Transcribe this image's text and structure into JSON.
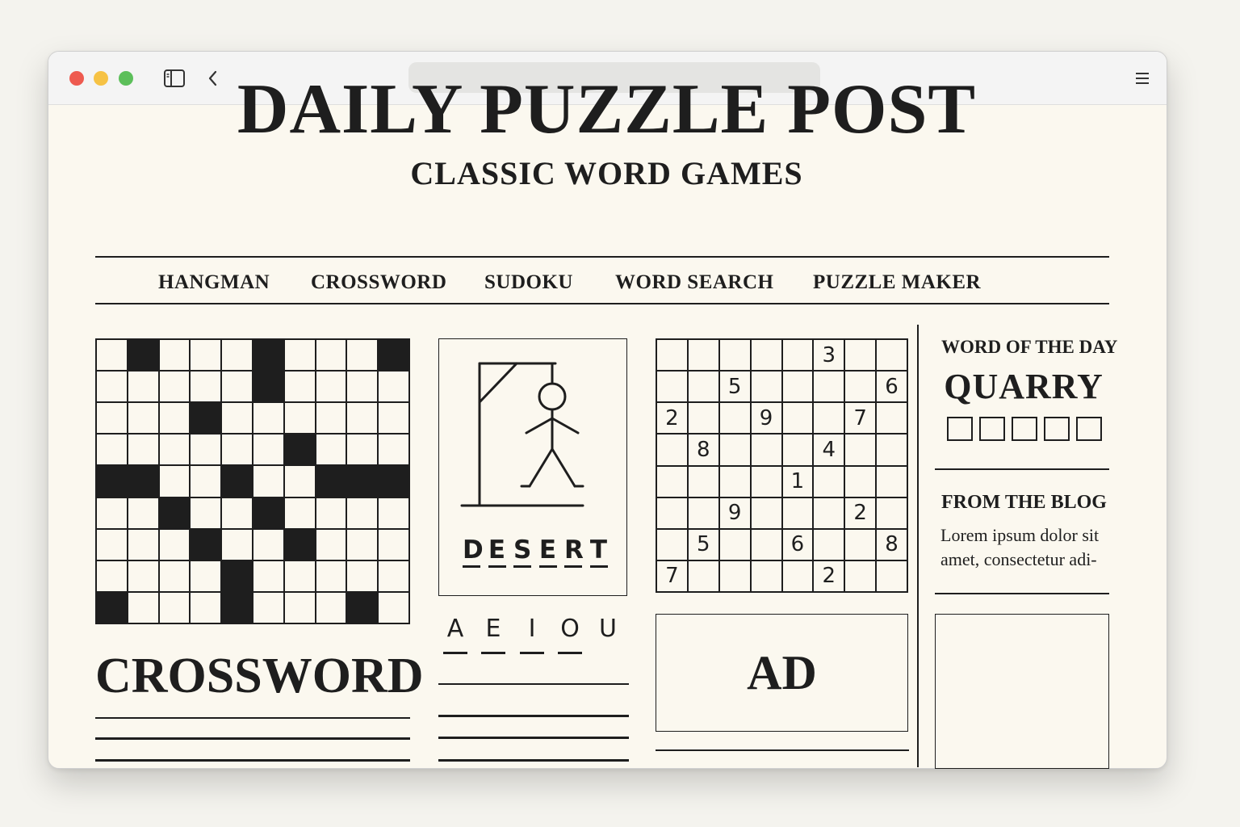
{
  "site": {
    "title": "DAILY PUZZLE POST",
    "subtitle": "CLASSIC WORD GAMES"
  },
  "nav": [
    "HANGMAN",
    "CROSSWORD",
    "SUDOKU",
    "WORD SEARCH",
    "PUZZLE MAKER"
  ],
  "crossword": {
    "title": "CROSSWORD",
    "rows": 9,
    "cols": 10,
    "black_cells": [
      [
        0,
        1
      ],
      [
        0,
        5
      ],
      [
        0,
        9
      ],
      [
        1,
        5
      ],
      [
        2,
        3
      ],
      [
        3,
        6
      ],
      [
        4,
        0
      ],
      [
        4,
        1
      ],
      [
        4,
        4
      ],
      [
        4,
        7
      ],
      [
        4,
        8
      ],
      [
        4,
        9
      ],
      [
        5,
        2
      ],
      [
        5,
        5
      ],
      [
        6,
        3
      ],
      [
        6,
        6
      ],
      [
        7,
        4
      ],
      [
        8,
        0
      ],
      [
        8,
        4
      ],
      [
        8,
        8
      ]
    ]
  },
  "hangman": {
    "word": [
      "D",
      "E",
      "S",
      "E",
      "R",
      "T"
    ],
    "vowels": [
      "A",
      "E",
      "I",
      "O",
      "U"
    ]
  },
  "sudoku": {
    "grid": [
      [
        "",
        "",
        "",
        "",
        "",
        "3",
        "",
        ""
      ],
      [
        "",
        "",
        "5",
        "",
        "",
        "",
        "",
        "6"
      ],
      [
        "2",
        "",
        "",
        "9",
        "",
        "",
        "7",
        ""
      ],
      [
        "",
        "8",
        "",
        "",
        "",
        "4",
        "",
        ""
      ],
      [
        "",
        "",
        "",
        "",
        "1",
        "",
        "",
        ""
      ],
      [
        "",
        "",
        "9",
        "",
        "",
        "",
        "2",
        ""
      ],
      [
        "",
        "5",
        "",
        "",
        "6",
        "",
        "",
        "8"
      ],
      [
        "7",
        "",
        "",
        "",
        "",
        "2",
        "",
        ""
      ]
    ]
  },
  "ad": {
    "label": "AD"
  },
  "word_of_the_day": {
    "label": "WORD OF THE DAY",
    "word": "QUARRY",
    "boxes": 5
  },
  "blog": {
    "label": "FROM THE BLOG",
    "excerpt": "Lorem ipsum dolor sit amet, consectetur adi-"
  },
  "icons": [
    "sidebar-toggle-icon",
    "back-chevron-icon",
    "hamburger-menu-icon"
  ]
}
